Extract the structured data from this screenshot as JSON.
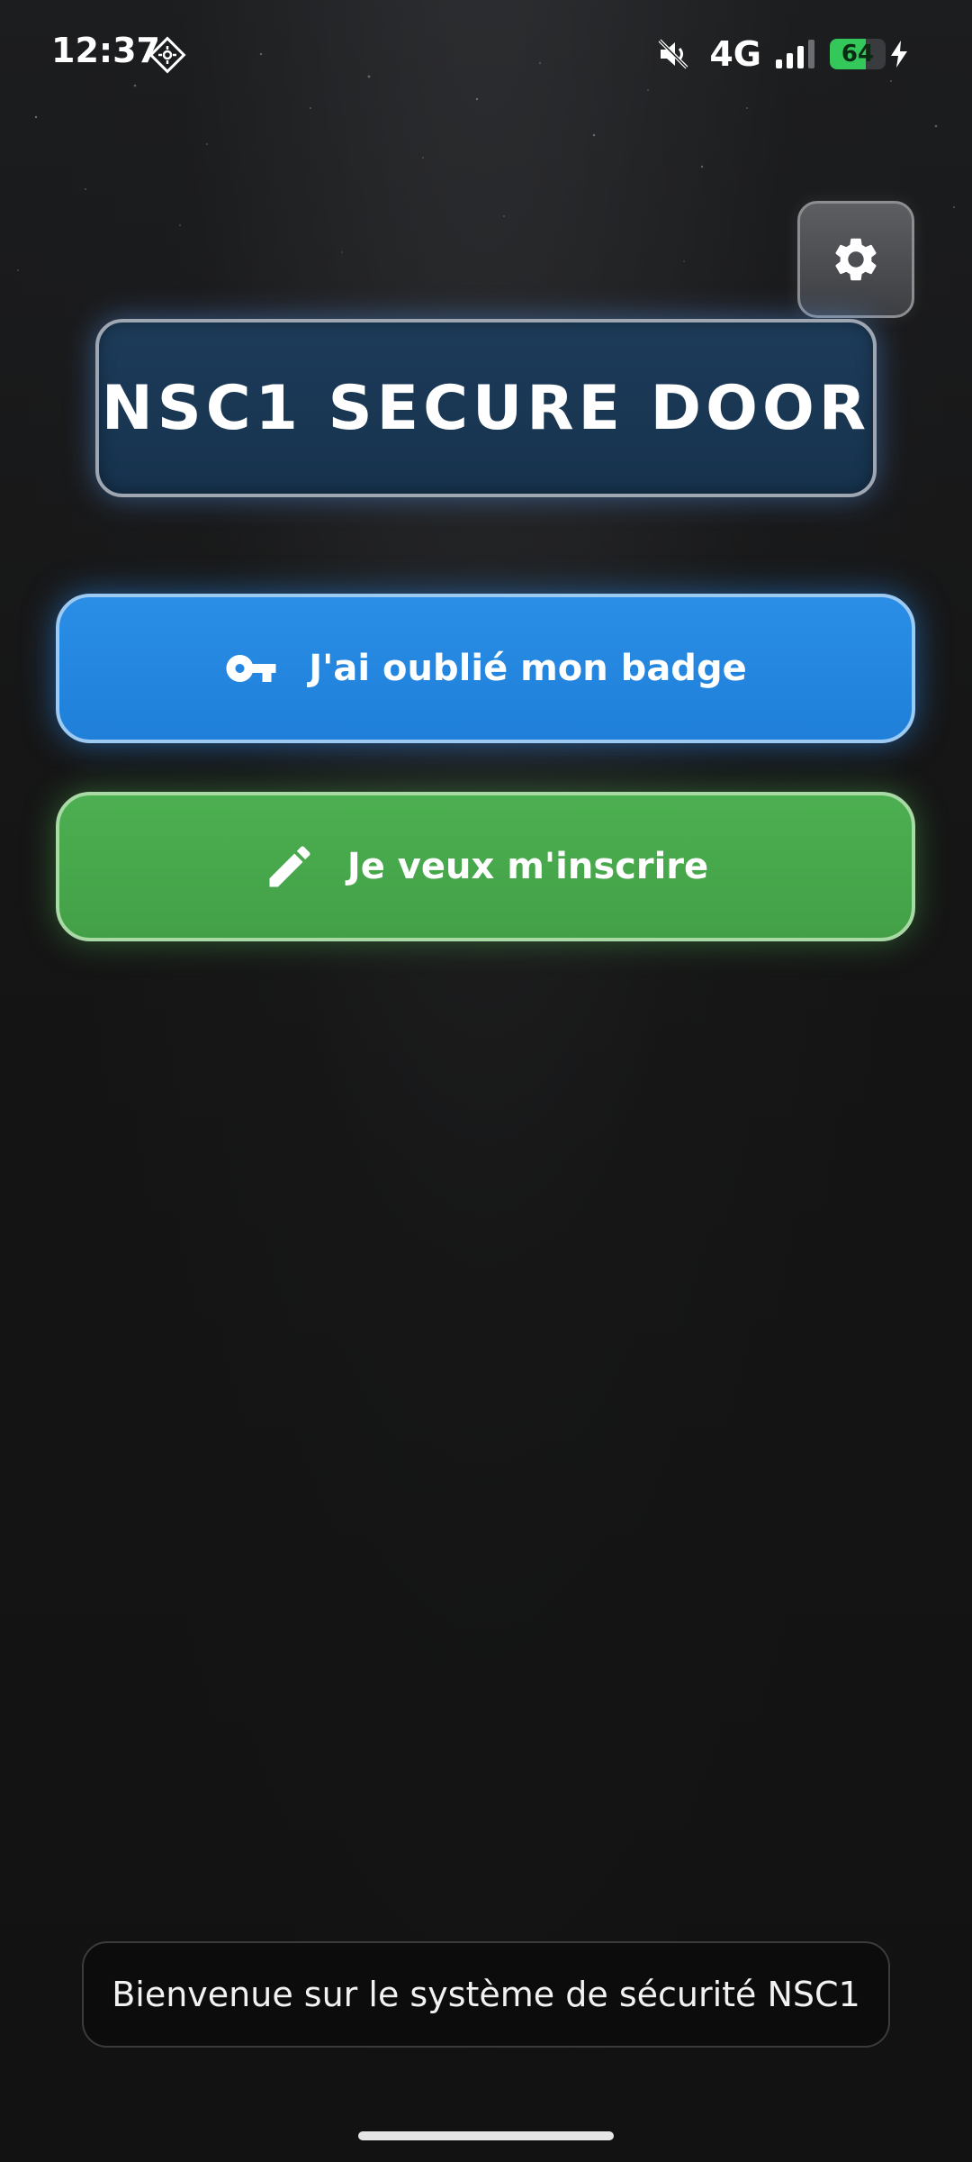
{
  "status_bar": {
    "time": "12:37",
    "network": "4G",
    "battery_level": 64,
    "battery_text": "64"
  },
  "header": {
    "title": "NSC1 SECURE DOOR"
  },
  "actions": {
    "forgot_badge_label": "J'ai oublié mon badge",
    "register_label": "Je veux m'inscrire"
  },
  "footer": {
    "message": "Bienvenue sur le système de sécurité NSC1"
  },
  "icons": {
    "settings": "gear-icon",
    "forgot_badge": "key-icon",
    "register": "pencil-icon"
  },
  "colors": {
    "background": "#121212",
    "title_card": "#1a3a58",
    "forgot_badge_button": "#2188e0",
    "register_button": "#48a84c",
    "battery_fill": "#34c759"
  }
}
